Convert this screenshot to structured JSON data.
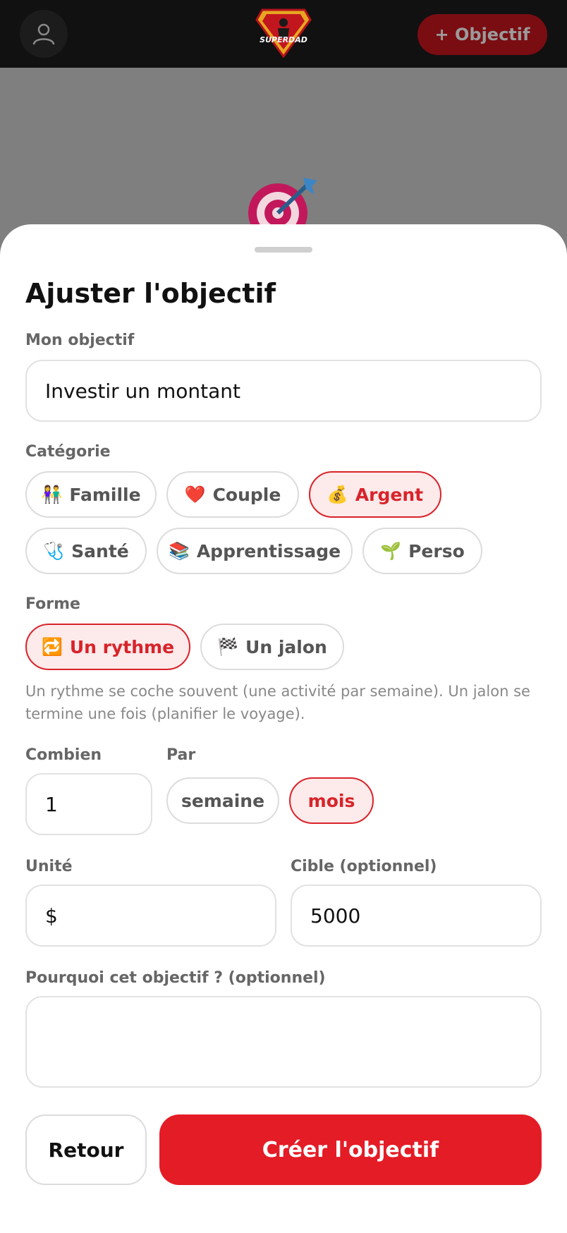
{
  "header": {
    "logo_text": "SUPERDAD",
    "add_goal_label": "+ Objectif"
  },
  "sheet": {
    "title": "Ajuster l'objectif",
    "goal": {
      "label": "Mon objectif",
      "value": "Investir un montant"
    },
    "category": {
      "label": "Catégorie",
      "options": [
        {
          "emoji": "👫",
          "label": "Famille"
        },
        {
          "emoji": "❤️",
          "label": "Couple"
        },
        {
          "emoji": "💰",
          "label": "Argent"
        },
        {
          "emoji": "🩺",
          "label": "Santé"
        },
        {
          "emoji": "📚",
          "label": "Apprentissage"
        },
        {
          "emoji": "🌱",
          "label": "Perso"
        }
      ],
      "selected": "Argent"
    },
    "form": {
      "label": "Forme",
      "options": [
        {
          "emoji": "🔁",
          "label": "Un rythme"
        },
        {
          "emoji": "🏁",
          "label": "Un jalon"
        }
      ],
      "selected": "Un rythme",
      "hint": "Un rythme se coche souvent (une activité par semaine). Un jalon se termine une fois (planifier le voyage)."
    },
    "combien": {
      "label": "Combien",
      "value": "1"
    },
    "par": {
      "label": "Par",
      "options": [
        "semaine",
        "mois"
      ],
      "selected": "mois"
    },
    "unite": {
      "label": "Unité",
      "value": "$"
    },
    "cible": {
      "label": "Cible (optionnel)",
      "value": "5000"
    },
    "pourquoi": {
      "label": "Pourquoi cet objectif ? (optionnel)",
      "value": ""
    },
    "actions": {
      "back_label": "Retour",
      "create_label": "Créer l'objectif"
    }
  },
  "colors": {
    "accent": "#e41c26",
    "accent_soft": "#fdeaea",
    "header_bg": "#111111",
    "overlay": "#7f7f7f"
  }
}
